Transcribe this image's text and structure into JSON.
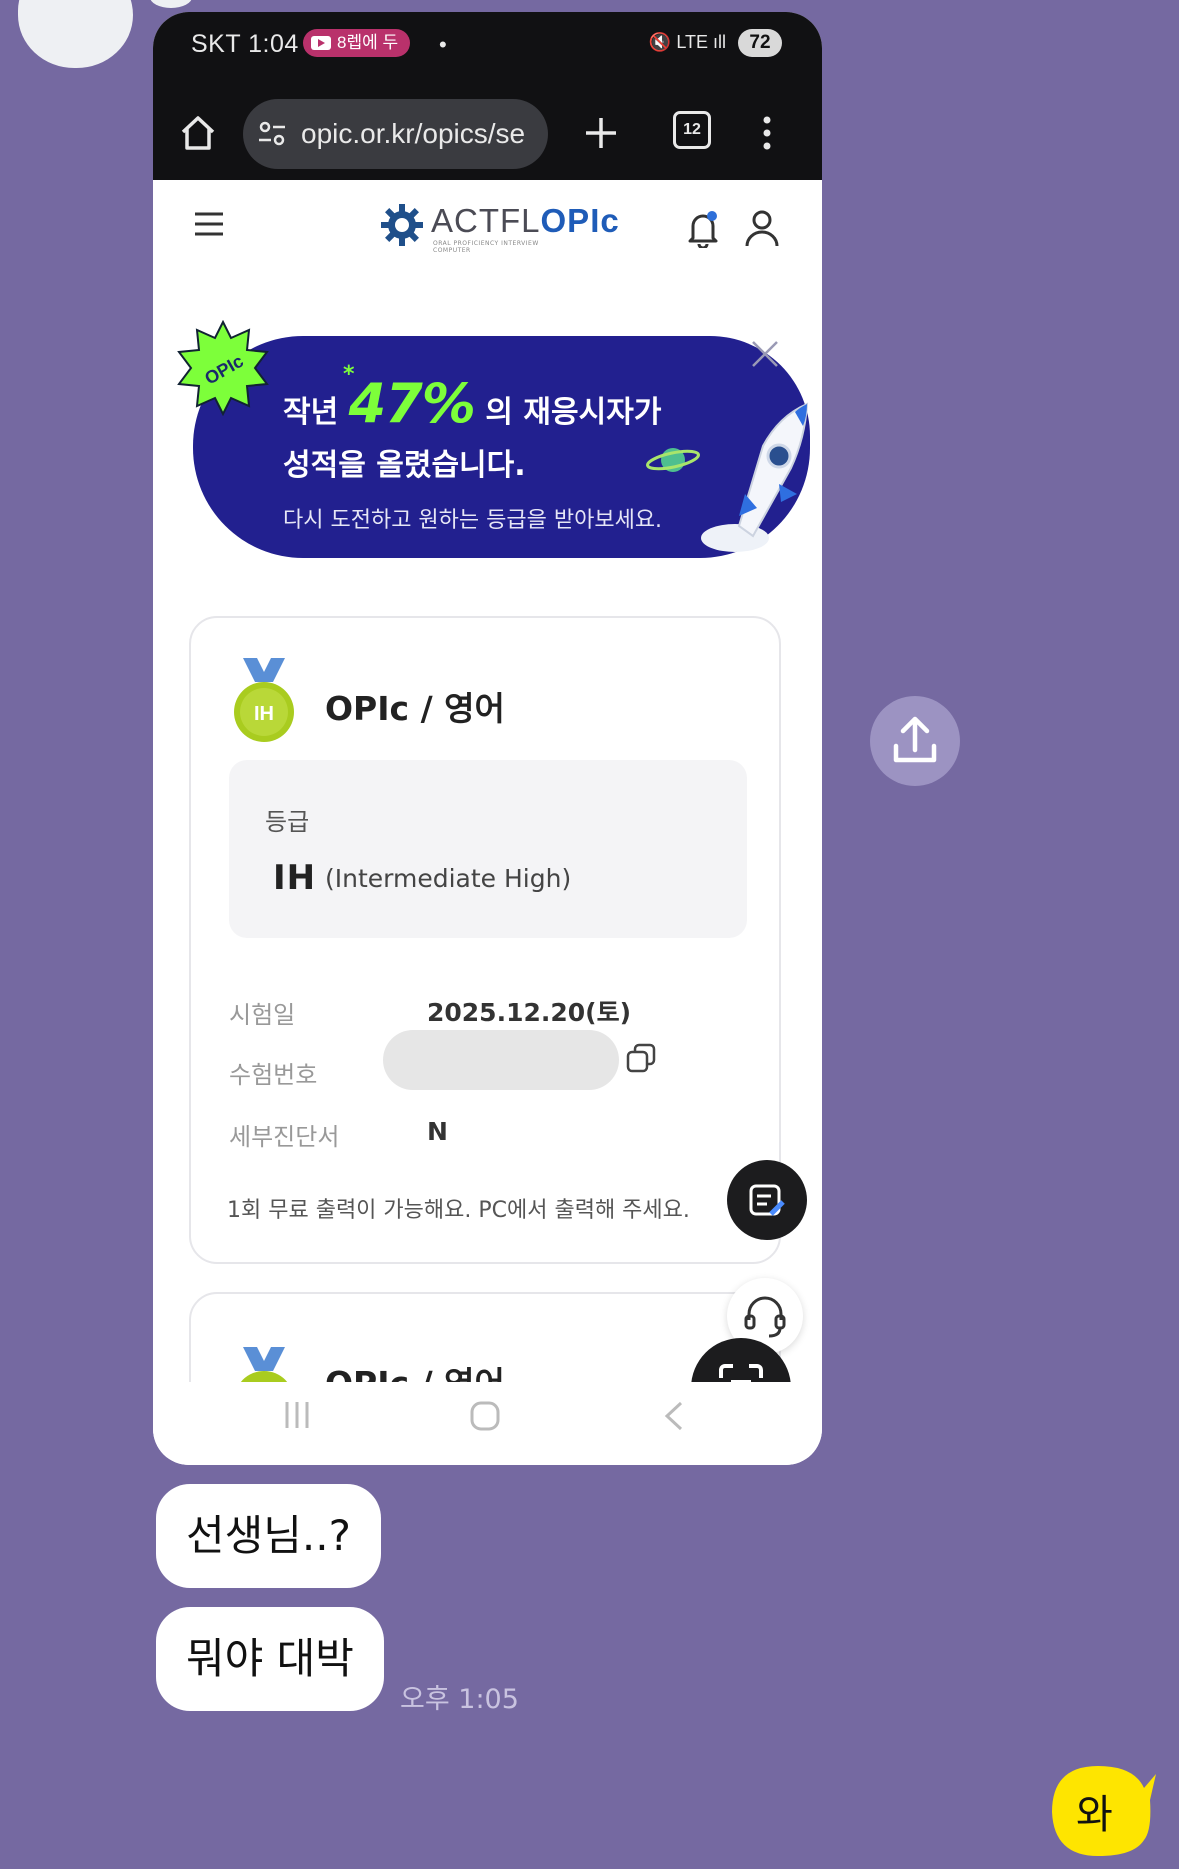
{
  "status_bar": {
    "carrier_time": "SKT 1:04",
    "notification_pill": "8렙에 두",
    "dot": "•",
    "signal_icons": "🔇 LTE ıll",
    "battery": "72"
  },
  "browser": {
    "url": "opic.or.kr/opics/se",
    "tab_count": "12"
  },
  "site_header": {
    "logo_prefix": "ACTFL",
    "logo_brand": "OPIc",
    "logo_sub": "ORAL PROFICIENCY INTERVIEW COMPUTER"
  },
  "banner": {
    "badge_text": "OPIc",
    "line1_before": "작년",
    "line1_number": "47%",
    "line1_after": "의 재응시자가",
    "line2": "성적을 올렸습니다.",
    "line3": "다시 도전하고 원하는 등급을 받아보세요.",
    "asterisk": "*"
  },
  "result_card": {
    "medal_text": "IH",
    "title": "OPIc / 영어",
    "grade_label": "등급",
    "grade_code": "IH",
    "grade_desc": "(Intermediate High)",
    "rows": [
      {
        "label": "시험일",
        "value": "2025.12.20(토)"
      },
      {
        "label": "수험번호",
        "value": ""
      },
      {
        "label": "세부진단서",
        "value": "N"
      }
    ],
    "note": "1회 무료 출력이 가능해요. PC에서 출력해 주세요."
  },
  "second_card": {
    "title": "OPIc / 영어"
  },
  "chat": {
    "message1": "선생님..?",
    "message2": "뭐야 대박",
    "time": "오후 1:05",
    "my_message": "와"
  },
  "colors": {
    "chat_background": "#7569a1",
    "banner_blue": "#22208f",
    "banner_green": "#7dff3a",
    "my_bubble": "#fee500"
  }
}
